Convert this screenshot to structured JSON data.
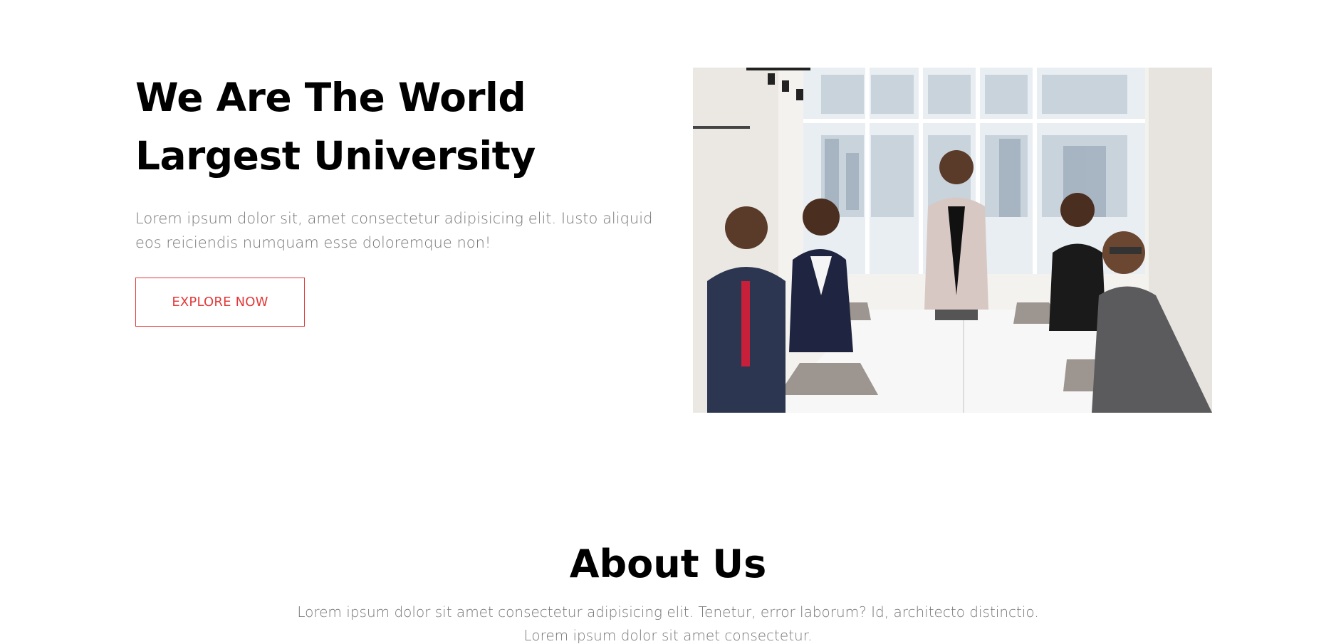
{
  "hero": {
    "title": "We Are The World Largest University",
    "description": "Lorem ipsum dolor sit, amet consectetur adipisicing elit. Iusto aliquid eos reiciendis numquam esse doloremque non!",
    "cta_label": "EXPLORE NOW",
    "image_alt": "meeting-photo"
  },
  "about": {
    "title": "About Us",
    "description": "Lorem ipsum dolor sit amet consectetur adipisicing elit. Tenetur, error laborum? Id, architecto distinctio. Lorem ipsum dolor sit amet consectetur."
  },
  "colors": {
    "accent": "#e23a3a",
    "text_muted": "#777777",
    "heading": "#000000"
  }
}
